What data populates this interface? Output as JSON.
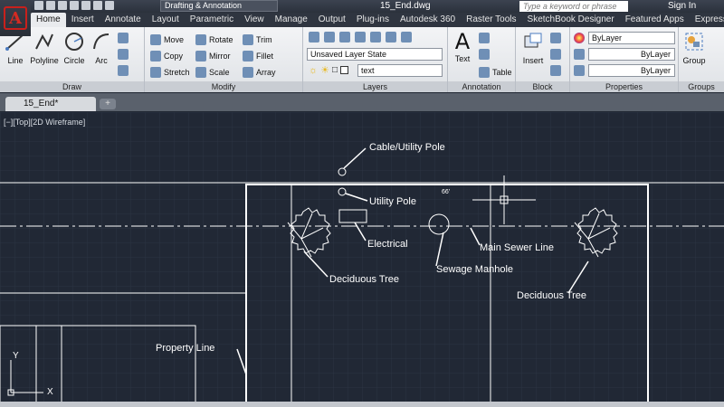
{
  "titlebar": {
    "workspace": "Drafting & Annotation",
    "document_title": "15_End.dwg",
    "search_placeholder": "Type a keyword or phrase",
    "sign_in": "Sign In"
  },
  "tabs": [
    "Home",
    "Insert",
    "Annotate",
    "Layout",
    "Parametric",
    "View",
    "Manage",
    "Output",
    "Plug-ins",
    "Autodesk 360",
    "Raster Tools",
    "SketchBook Designer",
    "Featured Apps",
    "Express Tools"
  ],
  "ribbon": {
    "draw": {
      "label": "Draw",
      "tools": [
        "Line",
        "Polyline",
        "Circle",
        "Arc"
      ]
    },
    "modify": {
      "label": "Modify",
      "tools": [
        "Move",
        "Rotate",
        "Trim",
        "Copy",
        "Mirror",
        "Fillet",
        "Stretch",
        "Scale",
        "Array"
      ]
    },
    "layers": {
      "label": "Layers",
      "layer_state": "Unsaved Layer State",
      "current_layer": "text"
    },
    "annotation": {
      "label": "Annotation",
      "tools": [
        "Text",
        "Table"
      ]
    },
    "block": {
      "label": "Block",
      "tools": [
        "Insert"
      ]
    },
    "properties": {
      "label": "Properties",
      "values": [
        "ByLayer",
        "ByLayer",
        "ByLayer"
      ]
    },
    "groups": {
      "label": "Groups",
      "tools": [
        "Group"
      ]
    }
  },
  "file_tab": "15_End*",
  "viewport_label": "[−][Top][2D Wireframe]",
  "drawing": {
    "dimension_text": "66'",
    "axis_x": "X",
    "axis_y": "Y",
    "labels": [
      "Cable/Utility Pole",
      "Utility Pole",
      "Electrical",
      "Main Sewer Line",
      "Sewage Manhole",
      "Deciduous Tree",
      "Deciduous Tree",
      "Property Line"
    ]
  },
  "colors": {
    "canvas": "#212835",
    "grid": "#2c3442",
    "linework": "#ffffff",
    "accent": "#c8201c"
  }
}
